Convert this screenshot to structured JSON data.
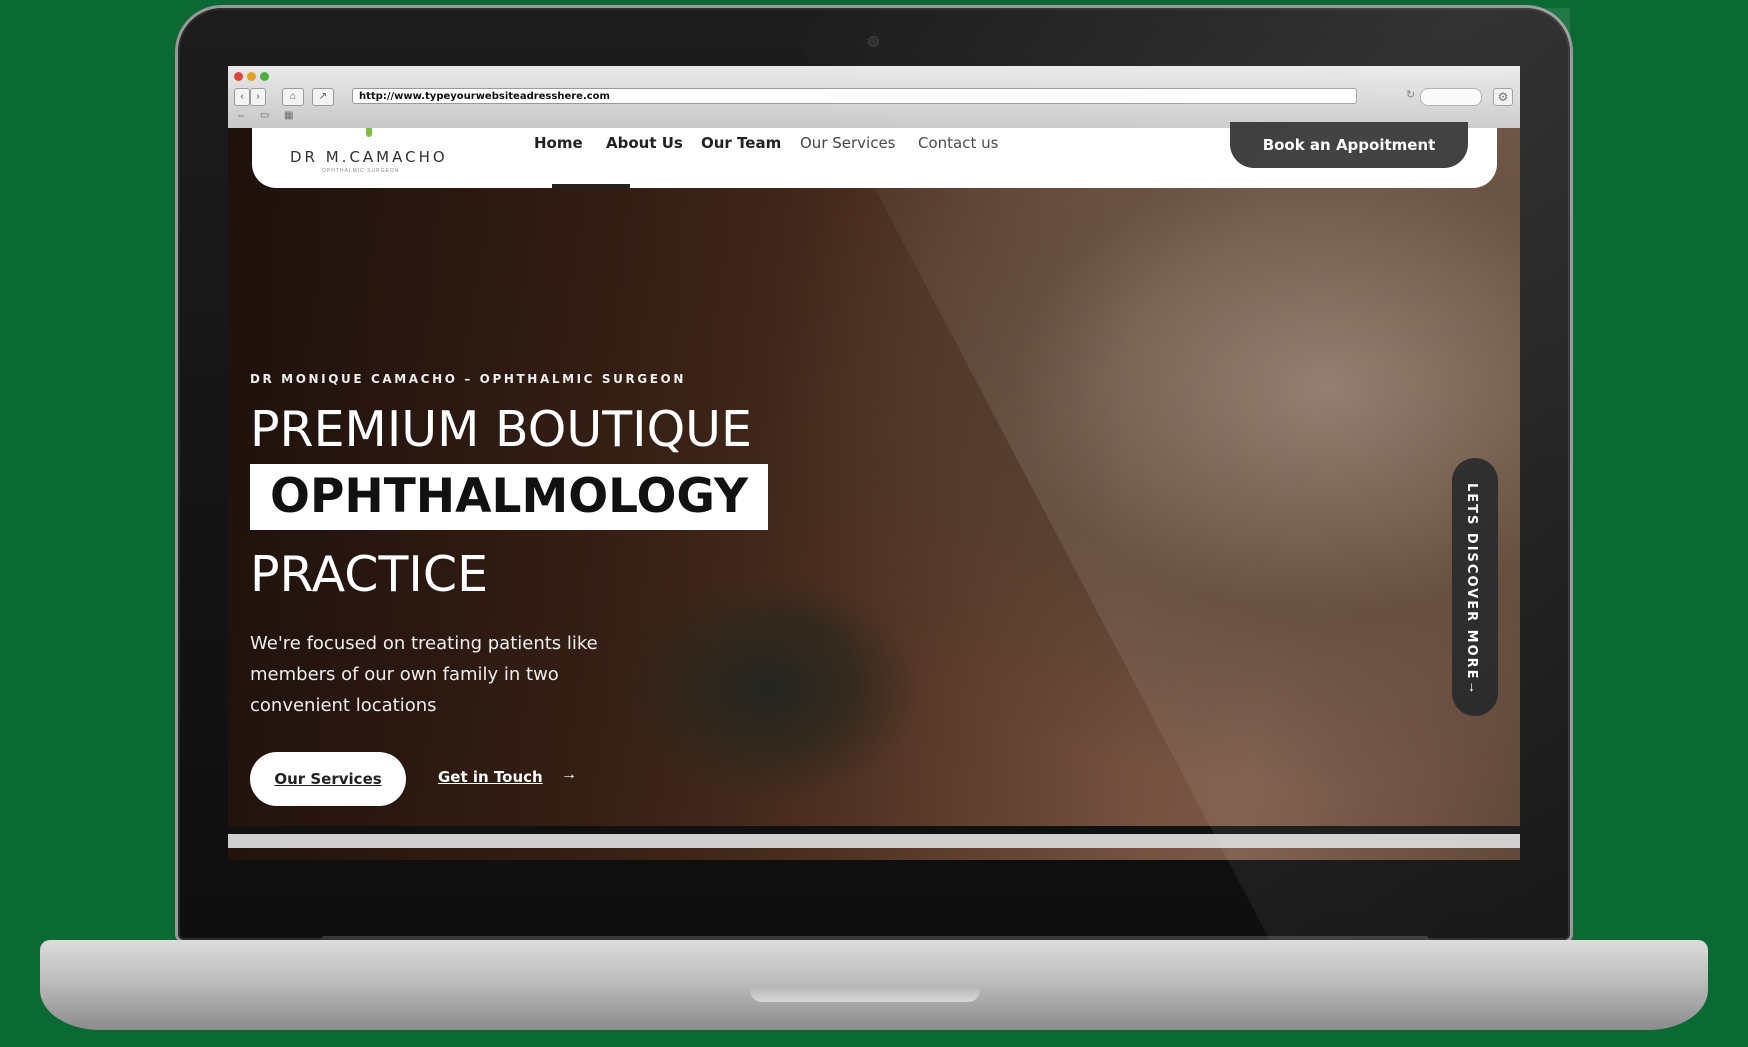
{
  "browser": {
    "url": "http://www.typeyourwebsiteadresshere.com"
  },
  "site": {
    "logo": "DR M.CAMACHO",
    "logo_sub": "OPHTHALMIC SURGEON",
    "nav": {
      "home": "Home",
      "about": "About Us",
      "team": "Our Team",
      "services": "Our Services",
      "contact": "Contact us"
    },
    "book_button": "Book an Appoitment"
  },
  "hero": {
    "eyebrow": "DR MONIQUE CAMACHO – OPHTHALMIC SURGEON",
    "title_line1": "PREMIUM BOUTIQUE",
    "title_highlight": "OPHTHALMOLOGY",
    "title_line3": "PRACTICE",
    "description": "We're focused on treating patients like members of our own family in two convenient locations",
    "primary_button": "Our Services",
    "secondary_link": "Get in Touch",
    "discover": "LETS DISCOVER MORE"
  },
  "icons": {
    "back": "back-arrow-icon",
    "forward": "forward-arrow-icon",
    "home": "home-icon",
    "share": "share-icon",
    "reload": "reload-icon",
    "settings": "gear-icon",
    "arrow_right": "arrow-right-icon",
    "arrow_down": "arrow-down-icon"
  },
  "colors": {
    "background": "#0b6a33",
    "brand_dark": "#2e2e2e",
    "logo_leaf": "#7bc143"
  }
}
